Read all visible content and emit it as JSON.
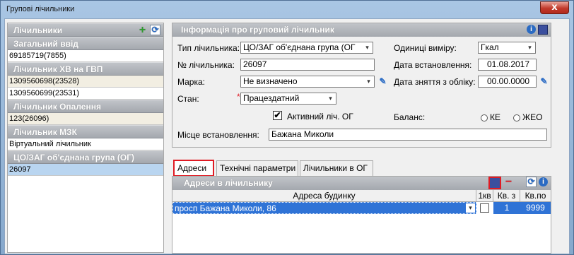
{
  "window": {
    "title": "Групові лічильники",
    "close_glyph": "x"
  },
  "left_panel": {
    "groups": [
      {
        "title": "Лічильники",
        "items": []
      },
      {
        "title": "Загальний ввід",
        "items": [
          {
            "text": "69185719(7855)"
          }
        ]
      },
      {
        "title": "Лічильник ХВ на ГВП",
        "items": [
          {
            "text": "1309560698(23528)"
          },
          {
            "text": "1309560699(23531)"
          }
        ]
      },
      {
        "title": "Лічильник Опалення",
        "items": [
          {
            "text": "123(26096)"
          }
        ]
      },
      {
        "title": "Лічильник МЗК",
        "items": [
          {
            "text": "Віртуальний лічильник"
          }
        ]
      },
      {
        "title": "ЦО/ЗАГ об'єднана група (ОГ)",
        "items": [
          {
            "text": "26097"
          }
        ]
      }
    ],
    "add_icon": "+",
    "refresh_icon": "⟳"
  },
  "info": {
    "title": "Інформація про груповий лічильник",
    "type_label": "Тип лічильника:",
    "type_value": "ЦО/ЗАГ об'єднана група (ОГ",
    "number_label": "№ лічильника:",
    "number_value": "26097",
    "brand_label": "Марка:",
    "brand_value": "Не визначено",
    "state_label": "Стан:",
    "state_required": "*",
    "state_value": "Працездатний",
    "active_label": "Активний ліч. ОГ",
    "active_checked": "✔",
    "location_label": "Місце встановлення:",
    "location_value": "Бажана Миколи",
    "units_label": "Одиниці виміру:",
    "units_value": "Гкал",
    "install_label": "Дата встановлення:",
    "install_value": "01.08.2017",
    "removal_label": "Дата зняття з обліку:",
    "removal_value": "00.00.0000",
    "balance_label": "Баланс:",
    "balance_opt1": "КЕ",
    "balance_opt2": "ЖЕО",
    "info_icon": "i"
  },
  "tabs": [
    {
      "label": "Адреси"
    },
    {
      "label": "Технічні параметри"
    },
    {
      "label": "Лічильники в ОГ"
    }
  ],
  "addresses": {
    "title": "Адреси в лічильнику",
    "columns": {
      "address": "Адреса будинку",
      "one_flat": "1кв",
      "flat_from": "Кв. з",
      "flat_to": "Кв.по"
    },
    "rows": [
      {
        "address": "просп Бажана Миколи, 86",
        "from": "1",
        "to": "9999"
      }
    ],
    "minus_icon": "−",
    "refresh_icon": "⟳",
    "info_icon": "i"
  }
}
